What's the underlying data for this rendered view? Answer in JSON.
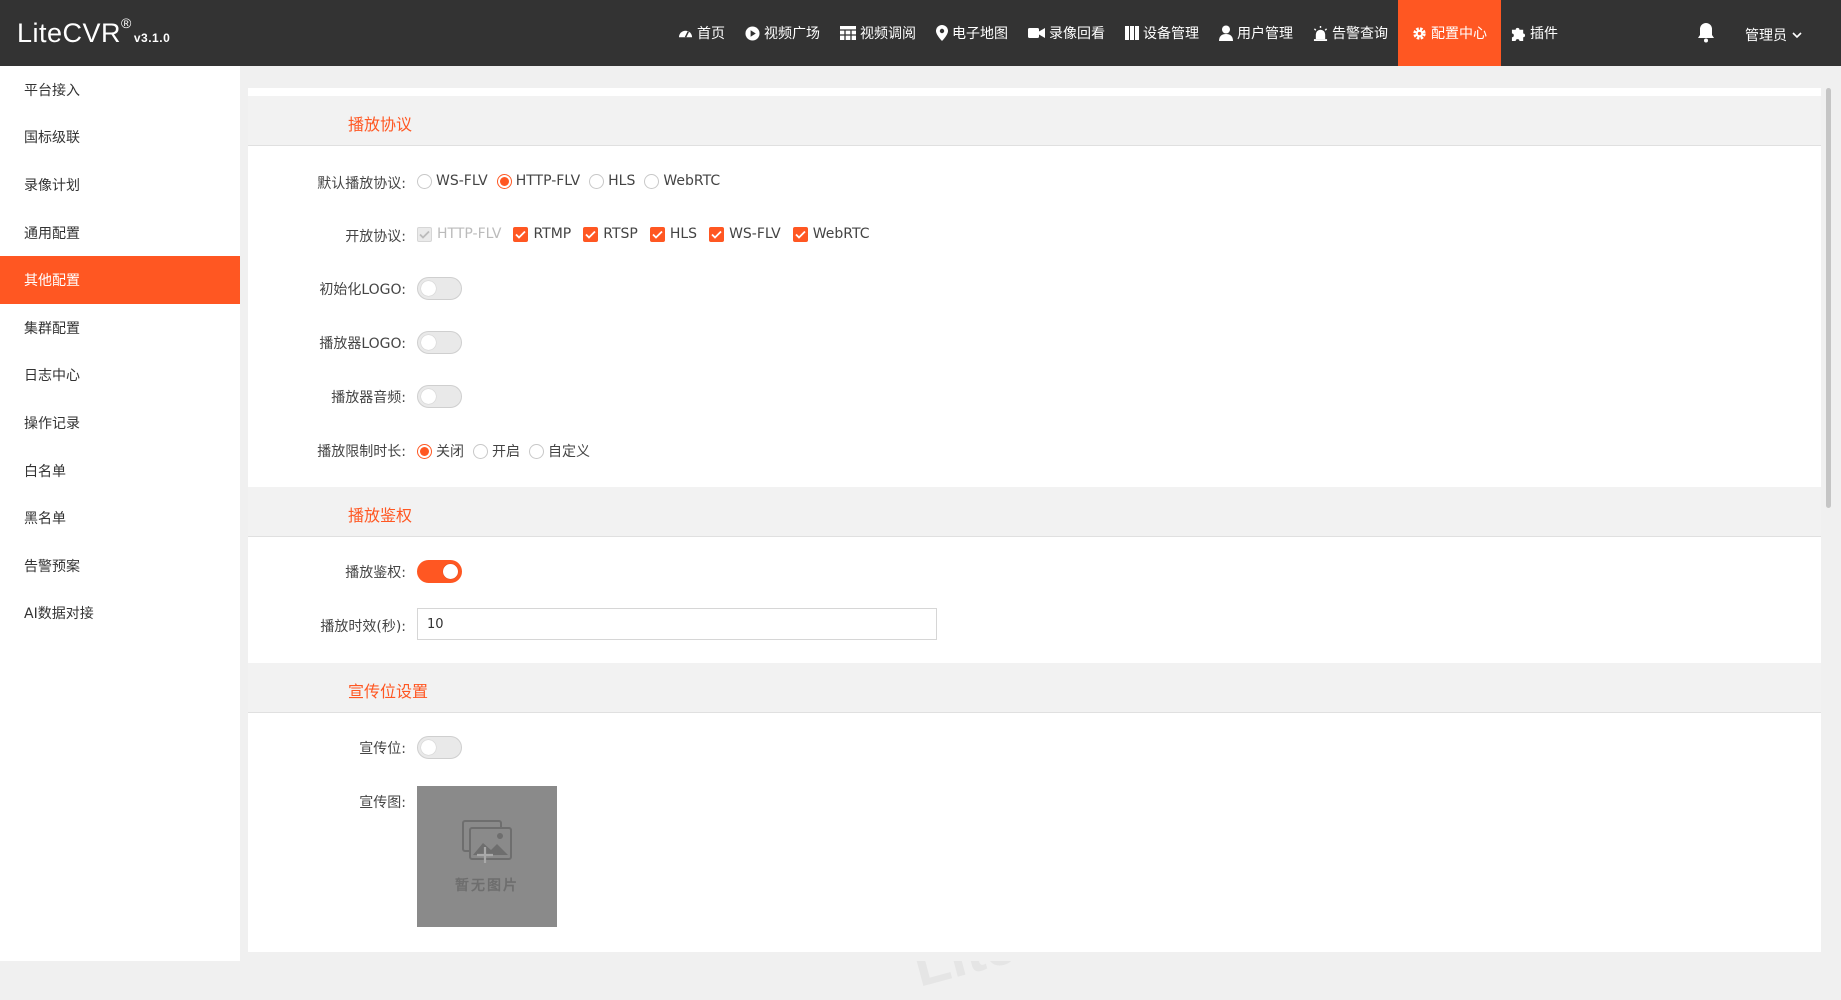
{
  "app": {
    "name": "LiteCVR",
    "trademark": "®",
    "version": "v3.1.0"
  },
  "nav": {
    "items": [
      {
        "label": "首页",
        "icon": "dashboard-icon",
        "active": false
      },
      {
        "label": "视频广场",
        "icon": "play-circle-icon",
        "active": false
      },
      {
        "label": "视频调阅",
        "icon": "grid-table-icon",
        "active": false
      },
      {
        "label": "电子地图",
        "icon": "map-pin-icon",
        "active": false
      },
      {
        "label": "录像回看",
        "icon": "video-camera-icon",
        "active": false
      },
      {
        "label": "设备管理",
        "icon": "columns-icon",
        "active": false
      },
      {
        "label": "用户管理",
        "icon": "user-icon",
        "active": false
      },
      {
        "label": "告警查询",
        "icon": "alarm-icon",
        "active": false
      },
      {
        "label": "配置中心",
        "icon": "gear-icon",
        "active": true
      },
      {
        "label": "插件",
        "icon": "puzzle-icon",
        "active": false
      }
    ],
    "user": "管理员"
  },
  "sidebar": {
    "items": [
      {
        "label": "平台接入",
        "active": false
      },
      {
        "label": "国标级联",
        "active": false
      },
      {
        "label": "录像计划",
        "active": false
      },
      {
        "label": "通用配置",
        "active": false
      },
      {
        "label": "其他配置",
        "active": true
      },
      {
        "label": "集群配置",
        "active": false
      },
      {
        "label": "日志中心",
        "active": false
      },
      {
        "label": "操作记录",
        "active": false
      },
      {
        "label": "白名单",
        "active": false
      },
      {
        "label": "黑名单",
        "active": false
      },
      {
        "label": "告警预案",
        "active": false
      },
      {
        "label": "AI数据对接",
        "active": false
      }
    ]
  },
  "sections": {
    "protocol": {
      "title": "播放协议"
    },
    "auth": {
      "title": "播放鉴权"
    },
    "promo": {
      "title": "宣传位设置"
    }
  },
  "form": {
    "default_protocol": {
      "label": "默认播放协议:",
      "options": [
        "WS-FLV",
        "HTTP-FLV",
        "HLS",
        "WebRTC"
      ],
      "selected": "HTTP-FLV"
    },
    "open_protocols": {
      "label": "开放协议:",
      "options": [
        {
          "label": "HTTP-FLV",
          "checked": true,
          "disabled": true
        },
        {
          "label": "RTMP",
          "checked": true,
          "disabled": false
        },
        {
          "label": "RTSP",
          "checked": true,
          "disabled": false
        },
        {
          "label": "HLS",
          "checked": true,
          "disabled": false
        },
        {
          "label": "WS-FLV",
          "checked": true,
          "disabled": false
        },
        {
          "label": "WebRTC",
          "checked": true,
          "disabled": false
        }
      ]
    },
    "init_logo": {
      "label": "初始化LOGO:",
      "on": false
    },
    "player_logo": {
      "label": "播放器LOGO:",
      "on": false
    },
    "player_audio": {
      "label": "播放器音频:",
      "on": false
    },
    "play_limit": {
      "label": "播放限制时长:",
      "options": [
        "关闭",
        "开启",
        "自定义"
      ],
      "selected": "关闭"
    },
    "play_auth": {
      "label": "播放鉴权:",
      "on": true
    },
    "play_validity": {
      "label": "播放时效(秒):",
      "value": "10"
    },
    "promo_slot": {
      "label": "宣传位:",
      "on": false
    },
    "promo_image": {
      "label": "宣传图:",
      "empty_text": "暂无图片"
    }
  },
  "watermark": "LiteMedia",
  "colors": {
    "accent": "#ff5722",
    "topbar": "#333333",
    "sidebar": "#ffffff"
  }
}
